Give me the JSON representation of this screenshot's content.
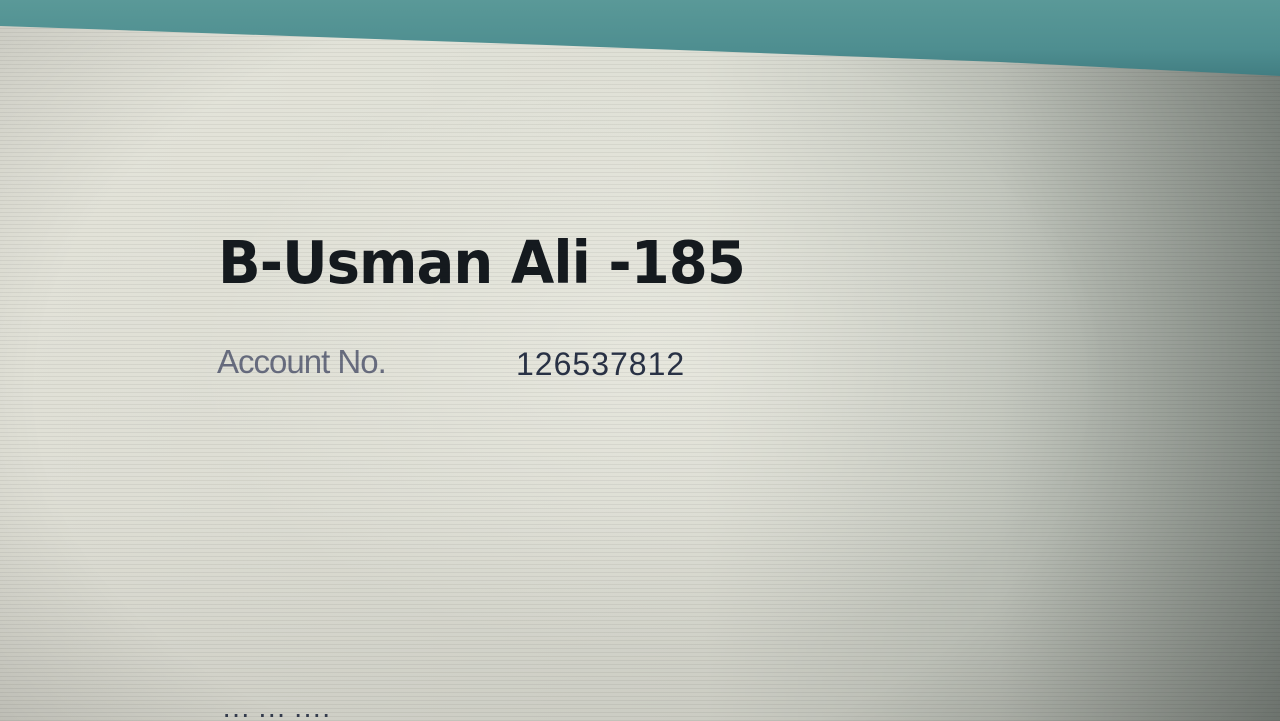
{
  "record": {
    "title": "B-Usman Ali -185",
    "account_label": "Account No.",
    "account_number": "126537812"
  },
  "bottom_line_partial": "··· ··· ····",
  "colors": {
    "top_band": "#4e8e90",
    "screen_background": "#e2e3d9",
    "title_text": "#151a1f",
    "label_text": "#6a6f82",
    "value_text": "#2a3347"
  }
}
